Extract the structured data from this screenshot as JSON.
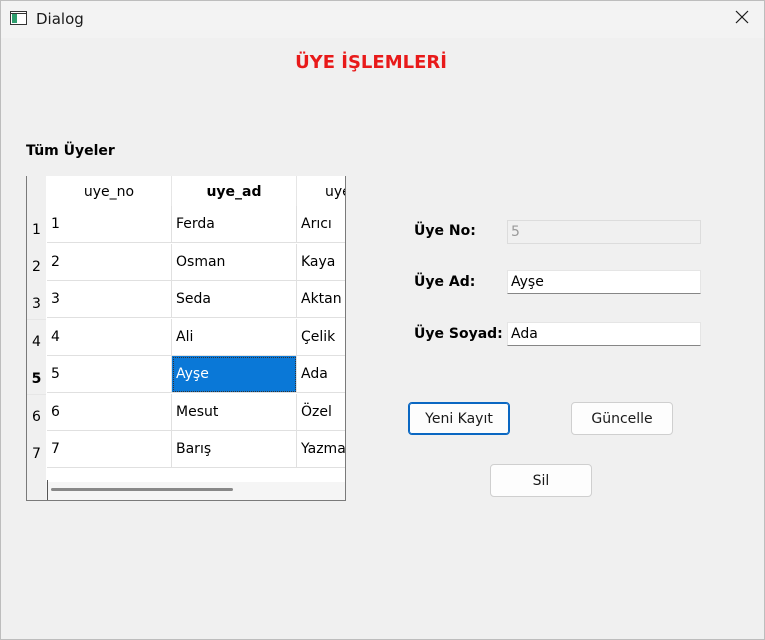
{
  "window": {
    "title": "Dialog"
  },
  "heading": "ÜYE İŞLEMLERİ",
  "section_label": "Tüm Üyeler",
  "table": {
    "columns": [
      "uye_no",
      "uye_ad",
      "uye_soyad"
    ],
    "visible_column_headers": [
      "uye_no",
      "uye_ad",
      "uye"
    ],
    "row_numbers": [
      "1",
      "2",
      "3",
      "4",
      "5",
      "6",
      "7"
    ],
    "current_row": 5,
    "selected_cell": {
      "row": 5,
      "column": "uye_ad"
    },
    "rows": [
      [
        "1",
        "Ferda",
        "Arıcı"
      ],
      [
        "2",
        "Osman",
        "Kaya"
      ],
      [
        "3",
        "Seda",
        "Aktan"
      ],
      [
        "4",
        "Ali",
        "Çelik"
      ],
      [
        "5",
        "Ayşe",
        "Ada"
      ],
      [
        "6",
        "Mesut",
        "Özel"
      ],
      [
        "7",
        "Barış",
        "Yazmar"
      ]
    ]
  },
  "form": {
    "uye_no_label": "Üye No:",
    "uye_no_value": "5",
    "uye_ad_label": "Üye Ad:",
    "uye_ad_value": "Ayşe",
    "uye_soyad_label": "Üye Soyad:",
    "uye_soyad_value": "Ada"
  },
  "buttons": {
    "new_record": "Yeni Kayıt",
    "update": "Güncelle",
    "delete": "Sil"
  },
  "colors": {
    "heading": "#e81a1a",
    "selection": "#0a78d7",
    "default_button_border": "#0a67c2"
  }
}
